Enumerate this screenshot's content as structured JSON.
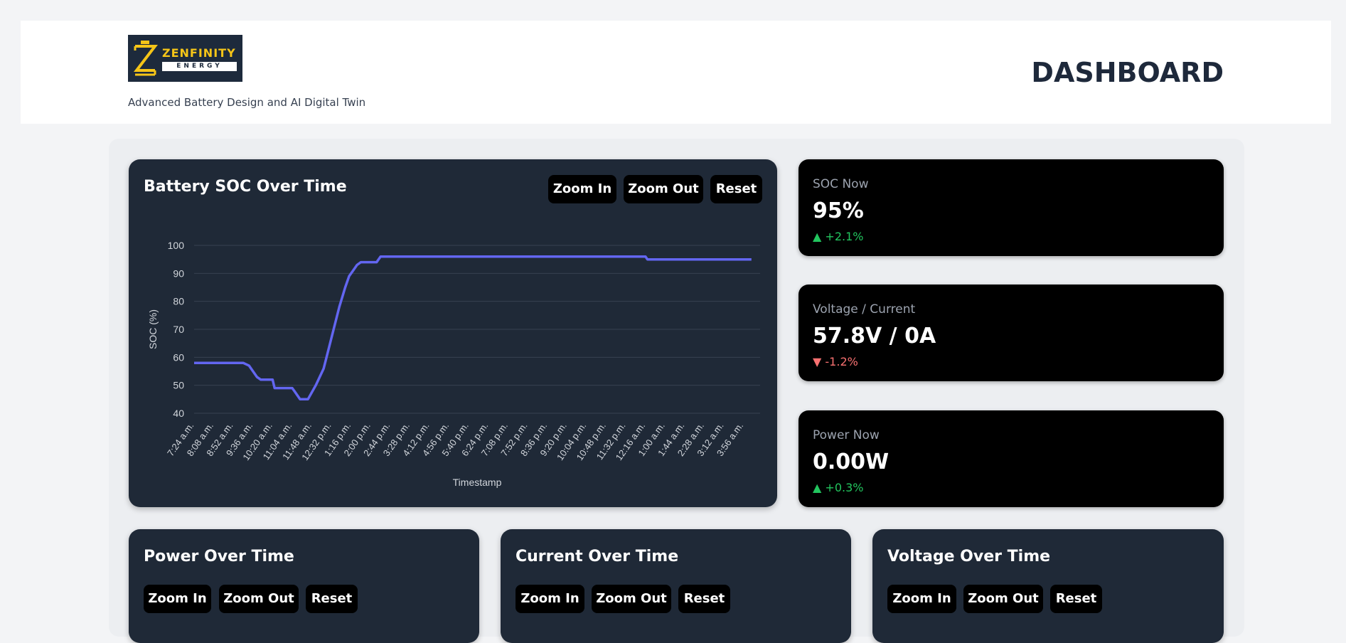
{
  "header": {
    "logo_word": "ZENFINITY",
    "logo_sub": "ENERGY",
    "tagline": "Advanced Battery Design and AI Digital Twin",
    "title": "DASHBOARD"
  },
  "controls": {
    "zoom_in": "Zoom In",
    "zoom_out": "Zoom Out",
    "reset": "Reset"
  },
  "soc_chart": {
    "title": "Battery SOC Over Time"
  },
  "stats": [
    {
      "label": "SOC Now",
      "value": "95%",
      "change": "+2.1%",
      "direction": "up"
    },
    {
      "label": "Voltage / Current",
      "value": "57.8V / 0A",
      "change": "-1.2%",
      "direction": "down"
    },
    {
      "label": "Power Now",
      "value": "0.00W",
      "change": "+0.3%",
      "direction": "up"
    }
  ],
  "bottom_cards": [
    {
      "title": "Power Over Time"
    },
    {
      "title": "Current Over Time"
    },
    {
      "title": "Voltage Over Time"
    }
  ],
  "colors": {
    "line": "#6366f1",
    "card_bg": "#1f2937",
    "positive": "#22c55e",
    "negative": "#f87171",
    "logo_accent": "#f5c518"
  },
  "chart_data": {
    "type": "line",
    "title": "Battery SOC Over Time",
    "xlabel": "Timestamp",
    "ylabel": "SOC (%)",
    "ylim": [
      40,
      100
    ],
    "yticks": [
      40,
      50,
      60,
      70,
      80,
      90,
      100
    ],
    "grid": true,
    "categories": [
      "7:24 a.m.",
      "8:08 a.m.",
      "8:52 a.m.",
      "9:36 a.m.",
      "10:20 a.m.",
      "11:04 a.m.",
      "11:48 a.m.",
      "12:32 p.m.",
      "1:16 p.m.",
      "2:00 p.m.",
      "2:44 p.m.",
      "3:28 p.m.",
      "4:12 p.m.",
      "4:56 p.m.",
      "5:40 p.m.",
      "6:24 p.m.",
      "7:08 p.m.",
      "7:52 p.m.",
      "8:36 p.m.",
      "9:20 p.m.",
      "10:04 p.m.",
      "10:48 p.m.",
      "11:32 p.m.",
      "12:16 a.m.",
      "1:00 a.m.",
      "1:44 a.m.",
      "2:28 a.m.",
      "3:12 a.m.",
      "3:56 a.m."
    ],
    "series": [
      {
        "points": [
          [
            0,
            58
          ],
          [
            2.5,
            58
          ],
          [
            2.8,
            57
          ],
          [
            3.0,
            55
          ],
          [
            3.2,
            53
          ],
          [
            3.4,
            52
          ],
          [
            4.0,
            52
          ],
          [
            4.1,
            49
          ],
          [
            5.0,
            49
          ],
          [
            5.1,
            48
          ],
          [
            5.3,
            46
          ],
          [
            5.4,
            45
          ],
          [
            5.8,
            45
          ],
          [
            6.2,
            50
          ],
          [
            6.6,
            56
          ],
          [
            7.0,
            67
          ],
          [
            7.4,
            78
          ],
          [
            7.7,
            85
          ],
          [
            7.9,
            89
          ],
          [
            8.1,
            91
          ],
          [
            8.3,
            93
          ],
          [
            8.5,
            94
          ],
          [
            9.3,
            94
          ],
          [
            9.5,
            96
          ],
          [
            23.0,
            96
          ],
          [
            23.1,
            95
          ],
          [
            28.4,
            95
          ]
        ]
      }
    ]
  }
}
